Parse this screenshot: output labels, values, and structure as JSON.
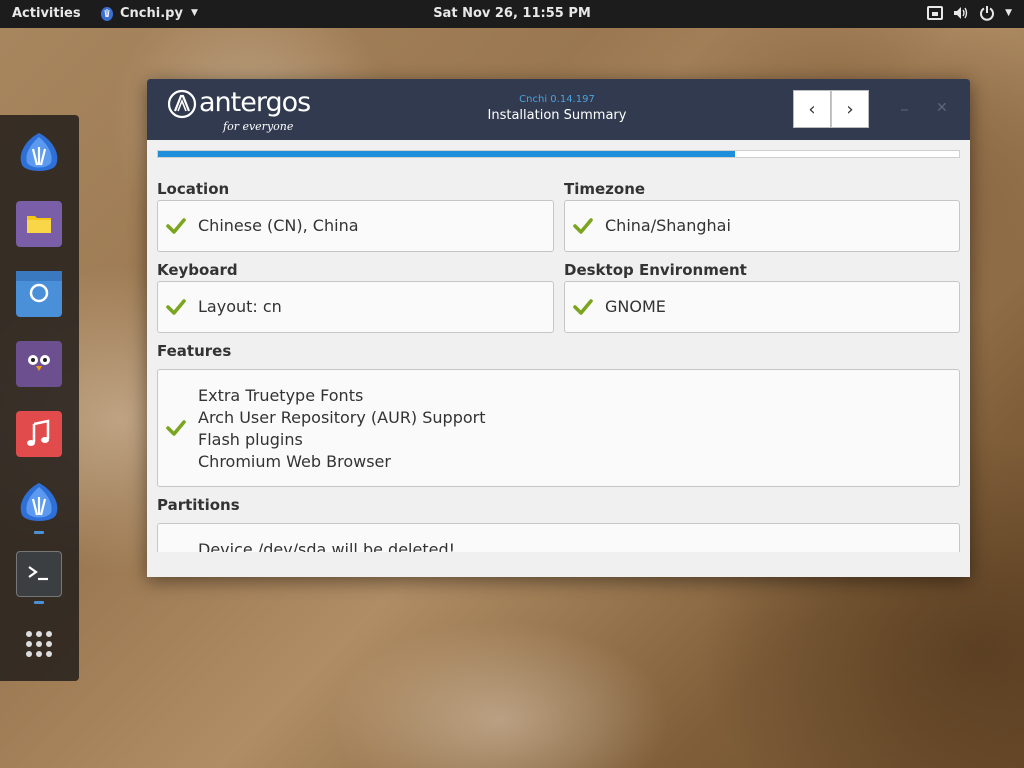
{
  "topbar": {
    "activities": "Activities",
    "app_name": "Cnchi.py",
    "clock": "Sat Nov 26, 11:55 PM",
    "icons": [
      "network-icon",
      "volume-icon",
      "power-icon",
      "caret-down-icon"
    ]
  },
  "dock": {
    "items": [
      {
        "name": "antergos-installer",
        "icon": "antergos-icon"
      },
      {
        "name": "files",
        "icon": "folder-icon"
      },
      {
        "name": "chromium",
        "icon": "browser-icon"
      },
      {
        "name": "pidgin",
        "icon": "bird-icon"
      },
      {
        "name": "music",
        "icon": "music-note-icon"
      },
      {
        "name": "cnchi",
        "icon": "antergos-icon"
      },
      {
        "name": "terminal",
        "icon": "terminal-icon"
      },
      {
        "name": "show-applications",
        "icon": "app-grid-icon"
      }
    ]
  },
  "window": {
    "logo": {
      "word": "antergos",
      "tagline": "for everyone"
    },
    "version": "Cnchi  0.14.197",
    "subtitle": "Installation Summary",
    "nav": {
      "back": "‹",
      "forward": "›"
    },
    "controls": {
      "minimize": "_",
      "close": "✕"
    },
    "progress": 0.72,
    "sections": {
      "location": {
        "label": "Location",
        "value": "Chinese (CN), China"
      },
      "timezone": {
        "label": "Timezone",
        "value": "China/Shanghai"
      },
      "keyboard": {
        "label": "Keyboard",
        "value": "Layout: cn"
      },
      "desktop": {
        "label": "Desktop Environment",
        "value": "GNOME"
      },
      "features": {
        "label": "Features",
        "items": [
          "Extra Truetype Fonts",
          "Arch User Repository (AUR) Support",
          "Flash plugins",
          "Chromium Web Browser"
        ]
      },
      "partitions": {
        "label": "Partitions",
        "value": "Device /dev/sda will be deleted!"
      }
    }
  },
  "colors": {
    "header": "#313a4f",
    "accent": "#1f8fdb",
    "check": "#7ba51f"
  }
}
